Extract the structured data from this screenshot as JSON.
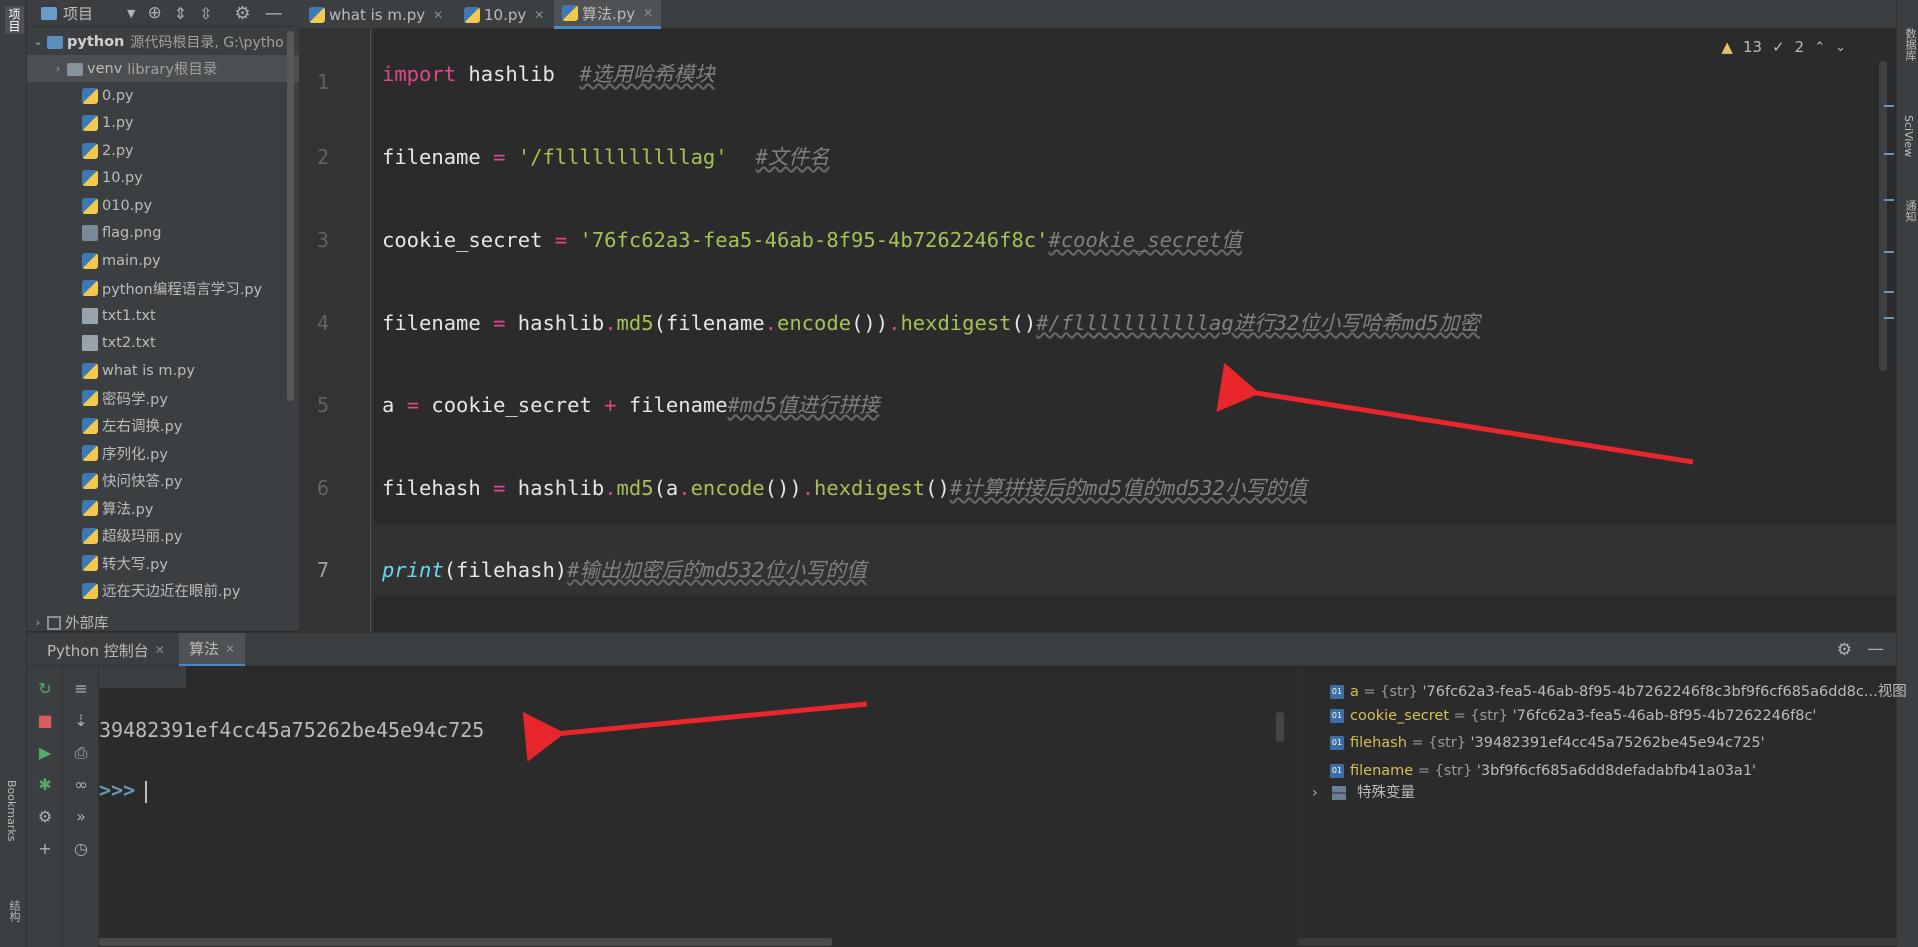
{
  "left_strip": {
    "project_label": "项目",
    "bookmarks_label": "Bookmarks",
    "structure_label": "结构"
  },
  "right_strip": {
    "db_label": "数据库",
    "sciview_label": "SciView",
    "notify_label": "通知"
  },
  "project_panel": {
    "title": "项目",
    "root": {
      "name": "python",
      "suffix": "源代码根目录, G:\\pytho"
    },
    "venv": {
      "name": "venv",
      "suffix": "library根目录"
    },
    "files": [
      "0.py",
      "1.py",
      "2.py",
      "10.py",
      "010.py",
      "flag.png",
      "main.py",
      "python编程语言学习.py",
      "txt1.txt",
      "txt2.txt",
      "what is m.py",
      "密码学.py",
      "左右调换.py",
      "序列化.py",
      "快问快答.py",
      "算法.py",
      "超级玛丽.py",
      "转大写.py",
      "远在天边近在眼前.py"
    ],
    "external": "外部库"
  },
  "editor_tabs": [
    {
      "label": "what is m.py"
    },
    {
      "label": "10.py"
    },
    {
      "label": "算法.py"
    }
  ],
  "inspections": {
    "warnings": "13",
    "weak": "2"
  },
  "code": {
    "line_numbers": [
      "1",
      "2",
      "3",
      "4",
      "5",
      "6",
      "7"
    ],
    "l1": {
      "kw": "import",
      "mod": " hashlib  ",
      "cm": "#选用哈希模块"
    },
    "l2": {
      "var": "filename ",
      "op": "=",
      "str": " '/flllllllllllag'",
      "cm": "#文件名"
    },
    "l3": {
      "var": "cookie_secret ",
      "op": "=",
      "str": " '76fc62a3-fea5-46ab-8f95-4b7262246f8c'",
      "cm": "#cookie_secret值"
    },
    "l4": {
      "a": "filename ",
      "op": "=",
      "b": " hashlib",
      "dot1": ".",
      "fn1": "md5",
      "c": "(filename",
      "dot2": ".",
      "fn2": "encode",
      "d": "())",
      "dot3": ".",
      "fn3": "hexdigest",
      "e": "()",
      "cm": "#/flllllllllllag进行32位小写哈希md5加密"
    },
    "l5": {
      "a": "a ",
      "op": "=",
      "b": " cookie_secret ",
      "op2": "+",
      "c": " filename",
      "cm": "#md5值进行拼接"
    },
    "l6": {
      "a": "filehash ",
      "op": "=",
      "b": " hashlib",
      "dot1": ".",
      "fn1": "md5",
      "c": "(a",
      "dot2": ".",
      "fn2": "encode",
      "d": "())",
      "dot3": ".",
      "fn3": "hexdigest",
      "e": "()",
      "cm": "#计算拼接后的md5值的md532小写的值"
    },
    "l7": {
      "fn": "print",
      "a": "(filehash)",
      "cm": "#输出加密后的md532位小写的值"
    }
  },
  "bottom_tabs": [
    {
      "label": "Python 控制台"
    },
    {
      "label": "算法"
    }
  ],
  "console": {
    "output": "39482391ef4cc45a75262be45e94c725",
    "prompt": ">>>"
  },
  "variables": [
    {
      "name": "a",
      "type": " = {str} ",
      "value": "'76fc62a3-fea5-46ab-8f95-4b7262246f8c3bf9f6cf685a6dd8c...视图"
    },
    {
      "name": "cookie_secret",
      "type": " = {str} ",
      "value": "'76fc62a3-fea5-46ab-8f95-4b7262246f8c'"
    },
    {
      "name": "filehash",
      "type": " = {str} ",
      "value": "'39482391ef4cc45a75262be45e94c725'"
    },
    {
      "name": "filename",
      "type": " = {str} ",
      "value": "'3bf9f6cf685a6dd8defadabfb41a03a1'"
    }
  ],
  "special_vars": "特殊变量",
  "colors": {
    "keyword": "#cc7832",
    "string": "#6a8759",
    "comment": "#808080",
    "function": "#ffc66d",
    "arrow": "#e8262b",
    "accent": "#4a88c7"
  },
  "icons": [
    "gear-icon",
    "minimize-icon",
    "locate-icon",
    "expand-all-icon",
    "collapse-all-icon",
    "rerun-icon",
    "stop-icon",
    "run-icon",
    "debug-icon",
    "settings-icon",
    "add-icon",
    "soft-wrap-icon",
    "scroll-end-icon",
    "print-icon",
    "glasses-icon",
    "history-icon",
    "clock-icon"
  ]
}
